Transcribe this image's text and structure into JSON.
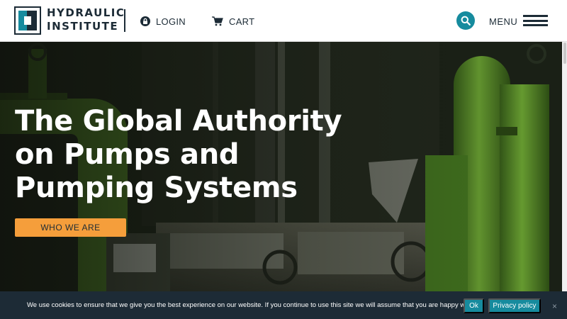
{
  "header": {
    "logo": {
      "line1": "HYDRAULIC",
      "line2": "INSTITUTE"
    },
    "nav": {
      "login_label": "LOGIN",
      "cart_label": "CART"
    },
    "menu_label": "MENU",
    "icons": {
      "login": "lock-icon",
      "cart": "cart-icon",
      "search": "search-icon",
      "menu": "hamburger-icon"
    }
  },
  "hero": {
    "title_line1": "The Global Authority",
    "title_line2": "on Pumps and",
    "title_line3": "Pumping Systems",
    "cta_label": "WHO WE ARE"
  },
  "cookie_bar": {
    "message": "We use cookies to ensure that we give you the best experience on our website. If you continue to use this site we will assume that you are happy with it.",
    "ok_label": "Ok",
    "policy_label": "Privacy policy",
    "close_label": "×"
  },
  "colors": {
    "brand_dark": "#1c2b36",
    "accent_teal": "#168b9e",
    "cta_orange": "#f59e3b",
    "pipe_green": "#6cae2e"
  }
}
